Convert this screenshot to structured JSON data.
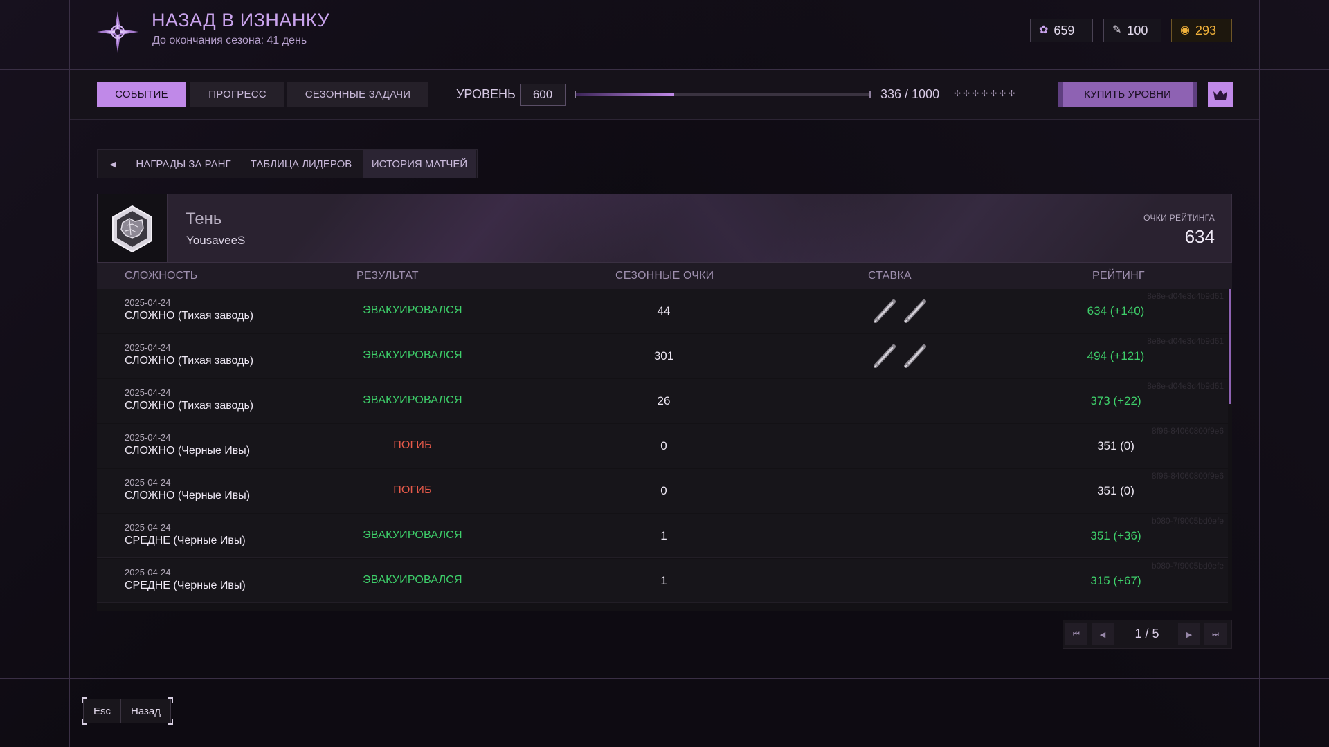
{
  "header": {
    "title": "НАЗАД В ИЗНАНКУ",
    "subtitle": "До окончания сезона: 41 день",
    "logo_icon": "compass-star-icon",
    "currencies": [
      {
        "icon": "flower-icon",
        "value": "659"
      },
      {
        "icon": "ticket-icon",
        "value": "100"
      },
      {
        "icon": "coin-icon",
        "value": "293",
        "color": "#f0b13a"
      }
    ]
  },
  "topnav": {
    "tabs": [
      {
        "label": "СОБЫТИЕ",
        "active": true
      },
      {
        "label": "ПРОГРЕСС",
        "active": false
      },
      {
        "label": "СЕЗОННЫЕ ЗАДАЧИ",
        "active": false
      }
    ],
    "level_label": "УРОВЕНЬ",
    "level_value": "600",
    "progress_text": "336 / 1000",
    "progress_fraction": 0.336,
    "stars": "✢✢✢✢✢✢✢",
    "buy_label": "КУПИТЬ УРОВНИ",
    "crown_icon": "crown-icon"
  },
  "subnav": {
    "back_icon": "triangle-left-icon",
    "tabs": [
      {
        "label": "НАГРАДЫ ЗА РАНГ",
        "active": false
      },
      {
        "label": "ТАБЛИЦА ЛИДЕРОВ",
        "active": false
      },
      {
        "label": "ИСТОРИЯ МАТЧЕЙ",
        "active": true
      }
    ]
  },
  "profile": {
    "rank": "Тень",
    "username": "YousaveeS",
    "score_label": "ОЧКИ РЕЙТИНГА",
    "score": "634"
  },
  "table": {
    "headers": [
      "СЛОЖНОСТЬ",
      "РЕЗУЛЬТАТ",
      "СЕЗОННЫЕ ОЧКИ",
      "СТАВКА",
      "РЕЙТИНГ"
    ],
    "rows": [
      {
        "date": "2025-04-24",
        "mode": "СЛОЖНО (Тихая заводь)",
        "result": "ЭВАКУИРОВАЛСЯ",
        "status": "ok",
        "season": "44",
        "bet": 2,
        "rating": "634 (+140)",
        "id": "8e8e-d04e3d4b9d61"
      },
      {
        "date": "2025-04-24",
        "mode": "СЛОЖНО (Тихая заводь)",
        "result": "ЭВАКУИРОВАЛСЯ",
        "status": "ok",
        "season": "301",
        "bet": 2,
        "rating": "494 (+121)",
        "id": "8e8e-d04e3d4b9d61"
      },
      {
        "date": "2025-04-24",
        "mode": "СЛОЖНО (Тихая заводь)",
        "result": "ЭВАКУИРОВАЛСЯ",
        "status": "ok",
        "season": "26",
        "bet": 0,
        "rating": "373 (+22)",
        "id": "8e8e-d04e3d4b9d61"
      },
      {
        "date": "2025-04-24",
        "mode": "СЛОЖНО (Черные Ивы)",
        "result": "ПОГИБ",
        "status": "dead",
        "season": "0",
        "bet": 0,
        "rating": "351 (0)",
        "id": "8f96-84060800f9e6"
      },
      {
        "date": "2025-04-24",
        "mode": "СЛОЖНО (Черные Ивы)",
        "result": "ПОГИБ",
        "status": "dead",
        "season": "0",
        "bet": 0,
        "rating": "351 (0)",
        "id": "8f96-84060800f9e6"
      },
      {
        "date": "2025-04-24",
        "mode": "СРЕДНЕ (Черные Ивы)",
        "result": "ЭВАКУИРОВАЛСЯ",
        "status": "ok",
        "season": "1",
        "bet": 0,
        "rating": "351 (+36)",
        "id": "b080-7f9005bd0efe"
      },
      {
        "date": "2025-04-24",
        "mode": "СРЕДНЕ (Черные Ивы)",
        "result": "ЭВАКУИРОВАЛСЯ",
        "status": "ok",
        "season": "1",
        "bet": 0,
        "rating": "315 (+67)",
        "id": "b080-7f9005bd0efe"
      }
    ],
    "colors": {
      "ok": "#3ecf6a",
      "dead": "#e85a4a"
    }
  },
  "pagination": {
    "text": "1 / 5"
  },
  "footer": {
    "esc_label": "Esc",
    "back_label": "Назад"
  }
}
